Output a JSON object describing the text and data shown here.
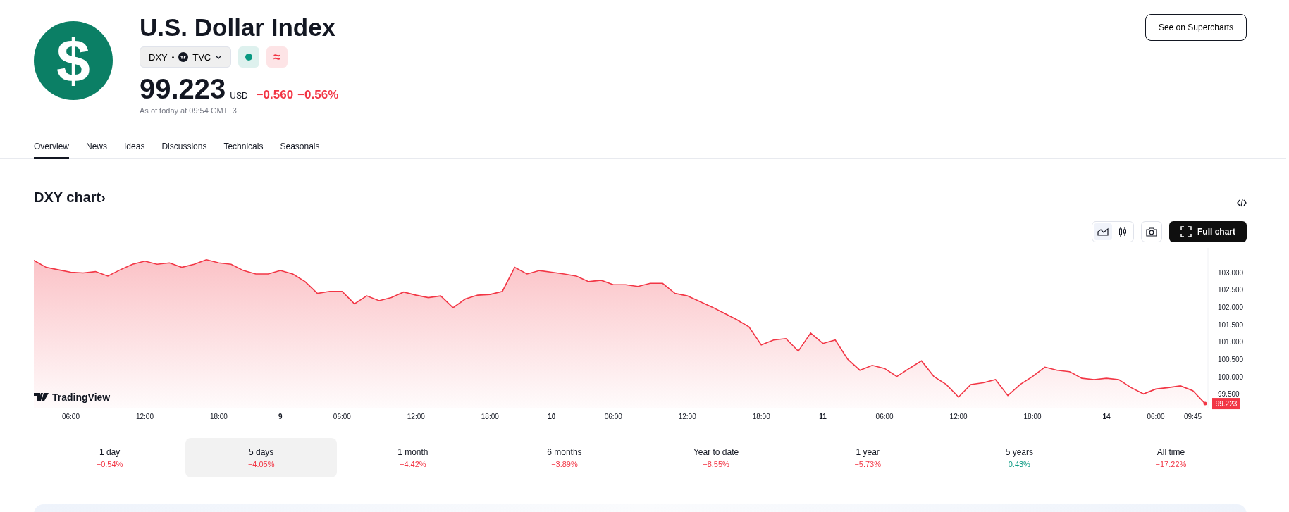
{
  "header": {
    "logo": {
      "symbol": "$"
    },
    "title": "U.S. Dollar Index",
    "ticker": {
      "symbol": "DXY",
      "separator": "•",
      "exchange": "TVC"
    },
    "badges": [
      {
        "kind": "dot",
        "color": "#089981"
      },
      {
        "kind": "text",
        "text": "≈",
        "color": "#f23645"
      }
    ],
    "price": "99.223",
    "currency": "USD",
    "change": "−0.560",
    "change_percent": "−0.56%",
    "as_of": "As of today at 09:54 GMT+3",
    "supercharts_button": "See on Supercharts"
  },
  "tabs": [
    {
      "label": "Overview",
      "selected": true
    },
    {
      "label": "News",
      "selected": false
    },
    {
      "label": "Ideas",
      "selected": false
    },
    {
      "label": "Discussions",
      "selected": false
    },
    {
      "label": "Technicals",
      "selected": false
    },
    {
      "label": "Seasonals",
      "selected": false
    }
  ],
  "chart_section": {
    "title": "DXY chart›",
    "style_toggles": [
      {
        "kind": "line",
        "selected": true
      },
      {
        "kind": "candles",
        "selected": false
      }
    ],
    "full_chart_button": "Full chart",
    "brand": "TradingView",
    "chart_data": {
      "type": "area",
      "categories": [
        null,
        null,
        null,
        "06:00",
        null,
        null,
        null,
        null,
        null,
        "12:00",
        null,
        null,
        null,
        null,
        null,
        "18:00",
        null,
        null,
        null,
        null,
        "9",
        null,
        null,
        null,
        null,
        "06:00",
        null,
        null,
        null,
        null,
        null,
        "12:00",
        null,
        null,
        null,
        null,
        null,
        "18:00",
        null,
        null,
        null,
        null,
        "10",
        null,
        null,
        null,
        null,
        "06:00",
        null,
        null,
        null,
        null,
        null,
        "12:00",
        null,
        null,
        null,
        null,
        null,
        "18:00",
        null,
        null,
        null,
        null,
        "11",
        null,
        null,
        null,
        null,
        "06:00",
        null,
        null,
        null,
        null,
        null,
        "12:00",
        null,
        null,
        null,
        null,
        null,
        "18:00",
        null,
        null,
        null,
        null,
        null,
        "14",
        null,
        null,
        null,
        "06:00",
        null,
        null,
        "09:45",
        null
      ],
      "series": [
        {
          "color": "#f23645",
          "values": [
            103.34,
            103.14,
            103.07,
            103.0,
            102.98,
            103.02,
            102.89,
            103.07,
            103.23,
            103.32,
            103.23,
            103.27,
            103.14,
            103.23,
            103.36,
            103.27,
            103.23,
            103.05,
            102.95,
            102.95,
            103.05,
            102.95,
            102.73,
            102.39,
            102.45,
            102.45,
            102.09,
            102.32,
            102.18,
            102.27,
            102.43,
            102.34,
            102.27,
            102.32,
            101.98,
            102.23,
            102.34,
            102.36,
            102.45,
            103.14,
            102.95,
            103.05,
            103.0,
            102.95,
            102.89,
            102.73,
            102.77,
            102.64,
            102.64,
            102.59,
            102.68,
            102.68,
            102.39,
            102.32,
            102.16,
            102.0,
            101.82,
            101.64,
            101.43,
            100.91,
            101.05,
            101.09,
            100.73,
            101.25,
            100.95,
            101.05,
            100.5,
            100.18,
            100.32,
            100.23,
            100.0,
            100.23,
            100.45,
            100.0,
            99.77,
            99.41,
            99.77,
            99.82,
            99.91,
            99.45,
            99.77,
            100.0,
            100.27,
            100.18,
            100.14,
            99.95,
            99.91,
            99.95,
            99.91,
            99.68,
            99.5,
            99.64,
            99.68,
            99.73,
            99.59,
            99.22
          ]
        }
      ],
      "yticks": [
        {
          "value": 103,
          "label": "103.000"
        },
        {
          "value": 102.5,
          "label": "102.500"
        },
        {
          "value": 102,
          "label": "102.000"
        },
        {
          "value": 101.5,
          "label": "101.500"
        },
        {
          "value": 101,
          "label": "101.000"
        },
        {
          "value": 100.5,
          "label": "100.500"
        },
        {
          "value": 100,
          "label": "100.000"
        },
        {
          "value": 99.5,
          "label": "99.500"
        }
      ],
      "ylim": [
        99.1,
        103.7
      ],
      "annotations": [
        "99.223"
      ]
    }
  },
  "periods": [
    {
      "label": "1 day",
      "change": "−0.54%",
      "color": "#f23645",
      "selected": false
    },
    {
      "label": "5 days",
      "change": "−4.05%",
      "color": "#f23645",
      "selected": true
    },
    {
      "label": "1 month",
      "change": "−4.42%",
      "color": "#f23645",
      "selected": false
    },
    {
      "label": "6 months",
      "change": "−3.89%",
      "color": "#f23645",
      "selected": false
    },
    {
      "label": "Year to date",
      "change": "−8.55%",
      "color": "#f23645",
      "selected": false
    },
    {
      "label": "1 year",
      "change": "−5.73%",
      "color": "#f23645",
      "selected": false
    },
    {
      "label": "5 years",
      "change": "0.43%",
      "color": "#089981",
      "selected": false
    },
    {
      "label": "All time",
      "change": "−17.22%",
      "color": "#f23645",
      "selected": false
    }
  ]
}
